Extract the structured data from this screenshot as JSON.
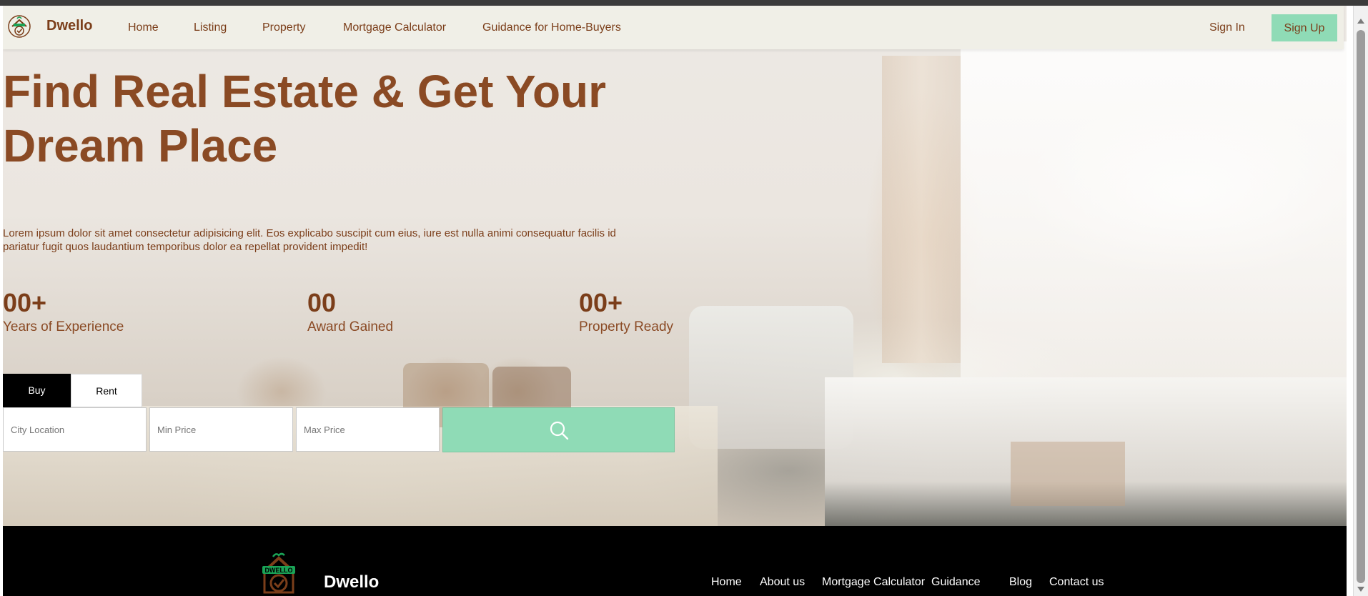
{
  "brand": {
    "name": "Dwello",
    "logo_text": "DWELLO"
  },
  "nav": {
    "links": [
      "Home",
      "Listing",
      "Property",
      "Mortgage Calculator",
      "Guidance for Home-Buyers"
    ],
    "sign_in": "Sign In",
    "sign_up": "Sign Up"
  },
  "hero": {
    "headline_line1": "Find Real Estate & Get Your",
    "headline_line2": "Dream Place",
    "description_line1": "Lorem ipsum dolor sit amet consectetur adipisicing elit. Eos explicabo suscipit cum eius, iure est nulla animi consequatur facilis id",
    "description_line2": "pariatur fugit quos laudantium temporibus dolor ea repellat provident impedit!",
    "stats": [
      {
        "value": "00+",
        "label": "Years of Experience"
      },
      {
        "value": "00",
        "label": "Award Gained"
      },
      {
        "value": "00+",
        "label": "Property Ready"
      }
    ]
  },
  "search": {
    "tabs": [
      "Buy",
      "Rent"
    ],
    "active_tab": "Buy",
    "city_placeholder": "City Location",
    "min_price_placeholder": "Min Price",
    "max_price_placeholder": "Max Price",
    "button_icon": "search-icon"
  },
  "footer": {
    "brand": "Dwello",
    "links": [
      "Home",
      "About us",
      "Mortgage Calculator",
      "Guidance",
      "Blog",
      "Contact us"
    ]
  },
  "colors": {
    "brand_brown": "#7b3e1a",
    "accent_green": "#8fdbb6",
    "navbar_bg": "#f0efe7",
    "footer_bg": "#000000"
  }
}
